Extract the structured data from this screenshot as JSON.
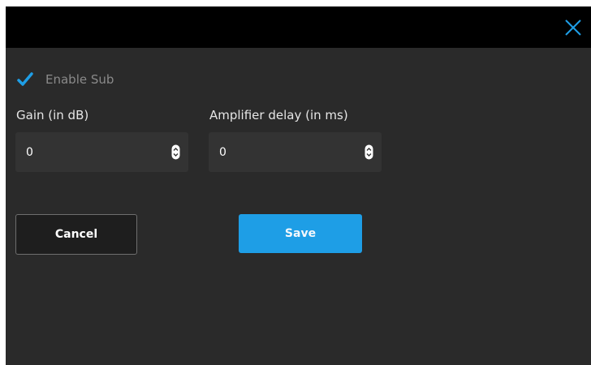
{
  "dialog": {
    "close_icon": "close-icon",
    "enable_sub": {
      "label": "Enable Sub",
      "checked": true
    },
    "gain": {
      "label": "Gain (in dB)",
      "value": "0"
    },
    "amp_delay": {
      "label": "Amplifier delay (in ms)",
      "value": "0"
    },
    "buttons": {
      "cancel": "Cancel",
      "save": "Save"
    }
  },
  "colors": {
    "accent": "#1e9ee6",
    "titlebar": "#000000",
    "panel": "#2a2a2a",
    "field": "#333333"
  }
}
